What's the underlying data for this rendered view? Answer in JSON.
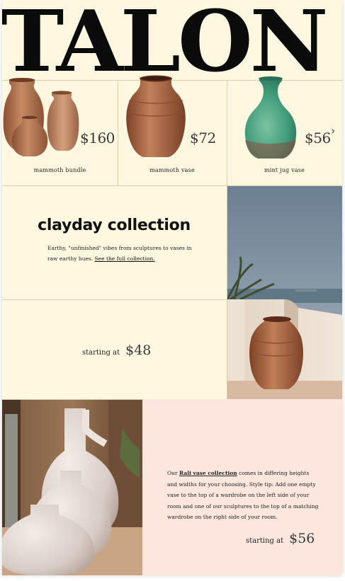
{
  "brand": {
    "name": "TALON"
  },
  "products": [
    {
      "name": "mammoth bundle",
      "price": "$160"
    },
    {
      "name": "mammoth vase",
      "price": "$72"
    },
    {
      "name": "mint jug vase",
      "price": "$56"
    }
  ],
  "nav": {
    "next_icon": "chevron-right-icon"
  },
  "collection": {
    "title": "clayday collection",
    "description": "Earthy, \"unfinished\" vibes from sculptures to vases in raw earthy hues.",
    "link_text": "See the full collection.",
    "starting_label": "starting at",
    "starting_price": "$48"
  },
  "rali": {
    "text_before": "Our ",
    "link_text": "Rali vase collection",
    "text_after": " comes in differing heights and widths for your choosing. Style tip: Add one empty vase to the top of a wardrobe on the left side of your room and one of our sculptures to the top of a matching wardrobe on the right side of your room.",
    "starting_label": "starting at",
    "starting_price": "$56"
  },
  "colors": {
    "background": "#fff7df",
    "pink_panel": "#fde6dd",
    "text": "#1b1b1b",
    "terracotta": "#b06a45",
    "mint": "#3f9b7a"
  }
}
